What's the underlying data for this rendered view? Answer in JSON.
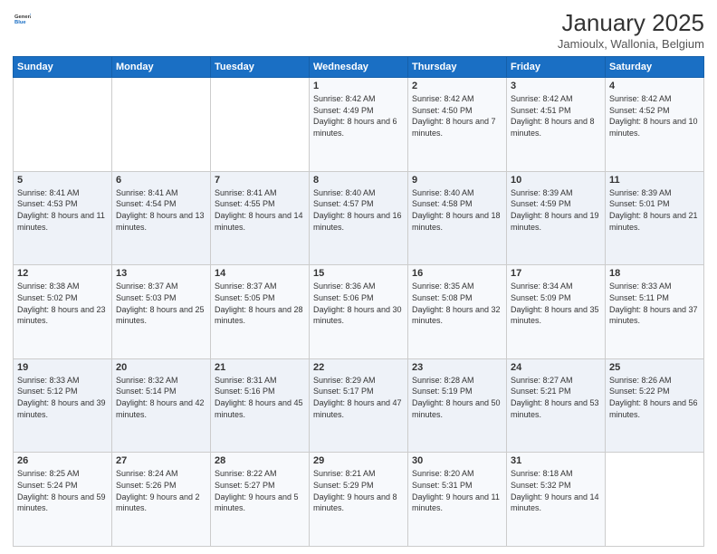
{
  "header": {
    "logo_line1": "General",
    "logo_line2": "Blue",
    "title": "January 2025",
    "subtitle": "Jamioulx, Wallonia, Belgium"
  },
  "weekdays": [
    "Sunday",
    "Monday",
    "Tuesday",
    "Wednesday",
    "Thursday",
    "Friday",
    "Saturday"
  ],
  "weeks": [
    [
      {
        "day": "",
        "sunrise": "",
        "sunset": "",
        "daylight": ""
      },
      {
        "day": "",
        "sunrise": "",
        "sunset": "",
        "daylight": ""
      },
      {
        "day": "",
        "sunrise": "",
        "sunset": "",
        "daylight": ""
      },
      {
        "day": "1",
        "sunrise": "Sunrise: 8:42 AM",
        "sunset": "Sunset: 4:49 PM",
        "daylight": "Daylight: 8 hours and 6 minutes."
      },
      {
        "day": "2",
        "sunrise": "Sunrise: 8:42 AM",
        "sunset": "Sunset: 4:50 PM",
        "daylight": "Daylight: 8 hours and 7 minutes."
      },
      {
        "day": "3",
        "sunrise": "Sunrise: 8:42 AM",
        "sunset": "Sunset: 4:51 PM",
        "daylight": "Daylight: 8 hours and 8 minutes."
      },
      {
        "day": "4",
        "sunrise": "Sunrise: 8:42 AM",
        "sunset": "Sunset: 4:52 PM",
        "daylight": "Daylight: 8 hours and 10 minutes."
      }
    ],
    [
      {
        "day": "5",
        "sunrise": "Sunrise: 8:41 AM",
        "sunset": "Sunset: 4:53 PM",
        "daylight": "Daylight: 8 hours and 11 minutes."
      },
      {
        "day": "6",
        "sunrise": "Sunrise: 8:41 AM",
        "sunset": "Sunset: 4:54 PM",
        "daylight": "Daylight: 8 hours and 13 minutes."
      },
      {
        "day": "7",
        "sunrise": "Sunrise: 8:41 AM",
        "sunset": "Sunset: 4:55 PM",
        "daylight": "Daylight: 8 hours and 14 minutes."
      },
      {
        "day": "8",
        "sunrise": "Sunrise: 8:40 AM",
        "sunset": "Sunset: 4:57 PM",
        "daylight": "Daylight: 8 hours and 16 minutes."
      },
      {
        "day": "9",
        "sunrise": "Sunrise: 8:40 AM",
        "sunset": "Sunset: 4:58 PM",
        "daylight": "Daylight: 8 hours and 18 minutes."
      },
      {
        "day": "10",
        "sunrise": "Sunrise: 8:39 AM",
        "sunset": "Sunset: 4:59 PM",
        "daylight": "Daylight: 8 hours and 19 minutes."
      },
      {
        "day": "11",
        "sunrise": "Sunrise: 8:39 AM",
        "sunset": "Sunset: 5:01 PM",
        "daylight": "Daylight: 8 hours and 21 minutes."
      }
    ],
    [
      {
        "day": "12",
        "sunrise": "Sunrise: 8:38 AM",
        "sunset": "Sunset: 5:02 PM",
        "daylight": "Daylight: 8 hours and 23 minutes."
      },
      {
        "day": "13",
        "sunrise": "Sunrise: 8:37 AM",
        "sunset": "Sunset: 5:03 PM",
        "daylight": "Daylight: 8 hours and 25 minutes."
      },
      {
        "day": "14",
        "sunrise": "Sunrise: 8:37 AM",
        "sunset": "Sunset: 5:05 PM",
        "daylight": "Daylight: 8 hours and 28 minutes."
      },
      {
        "day": "15",
        "sunrise": "Sunrise: 8:36 AM",
        "sunset": "Sunset: 5:06 PM",
        "daylight": "Daylight: 8 hours and 30 minutes."
      },
      {
        "day": "16",
        "sunrise": "Sunrise: 8:35 AM",
        "sunset": "Sunset: 5:08 PM",
        "daylight": "Daylight: 8 hours and 32 minutes."
      },
      {
        "day": "17",
        "sunrise": "Sunrise: 8:34 AM",
        "sunset": "Sunset: 5:09 PM",
        "daylight": "Daylight: 8 hours and 35 minutes."
      },
      {
        "day": "18",
        "sunrise": "Sunrise: 8:33 AM",
        "sunset": "Sunset: 5:11 PM",
        "daylight": "Daylight: 8 hours and 37 minutes."
      }
    ],
    [
      {
        "day": "19",
        "sunrise": "Sunrise: 8:33 AM",
        "sunset": "Sunset: 5:12 PM",
        "daylight": "Daylight: 8 hours and 39 minutes."
      },
      {
        "day": "20",
        "sunrise": "Sunrise: 8:32 AM",
        "sunset": "Sunset: 5:14 PM",
        "daylight": "Daylight: 8 hours and 42 minutes."
      },
      {
        "day": "21",
        "sunrise": "Sunrise: 8:31 AM",
        "sunset": "Sunset: 5:16 PM",
        "daylight": "Daylight: 8 hours and 45 minutes."
      },
      {
        "day": "22",
        "sunrise": "Sunrise: 8:29 AM",
        "sunset": "Sunset: 5:17 PM",
        "daylight": "Daylight: 8 hours and 47 minutes."
      },
      {
        "day": "23",
        "sunrise": "Sunrise: 8:28 AM",
        "sunset": "Sunset: 5:19 PM",
        "daylight": "Daylight: 8 hours and 50 minutes."
      },
      {
        "day": "24",
        "sunrise": "Sunrise: 8:27 AM",
        "sunset": "Sunset: 5:21 PM",
        "daylight": "Daylight: 8 hours and 53 minutes."
      },
      {
        "day": "25",
        "sunrise": "Sunrise: 8:26 AM",
        "sunset": "Sunset: 5:22 PM",
        "daylight": "Daylight: 8 hours and 56 minutes."
      }
    ],
    [
      {
        "day": "26",
        "sunrise": "Sunrise: 8:25 AM",
        "sunset": "Sunset: 5:24 PM",
        "daylight": "Daylight: 8 hours and 59 minutes."
      },
      {
        "day": "27",
        "sunrise": "Sunrise: 8:24 AM",
        "sunset": "Sunset: 5:26 PM",
        "daylight": "Daylight: 9 hours and 2 minutes."
      },
      {
        "day": "28",
        "sunrise": "Sunrise: 8:22 AM",
        "sunset": "Sunset: 5:27 PM",
        "daylight": "Daylight: 9 hours and 5 minutes."
      },
      {
        "day": "29",
        "sunrise": "Sunrise: 8:21 AM",
        "sunset": "Sunset: 5:29 PM",
        "daylight": "Daylight: 9 hours and 8 minutes."
      },
      {
        "day": "30",
        "sunrise": "Sunrise: 8:20 AM",
        "sunset": "Sunset: 5:31 PM",
        "daylight": "Daylight: 9 hours and 11 minutes."
      },
      {
        "day": "31",
        "sunrise": "Sunrise: 8:18 AM",
        "sunset": "Sunset: 5:32 PM",
        "daylight": "Daylight: 9 hours and 14 minutes."
      },
      {
        "day": "",
        "sunrise": "",
        "sunset": "",
        "daylight": ""
      }
    ]
  ]
}
